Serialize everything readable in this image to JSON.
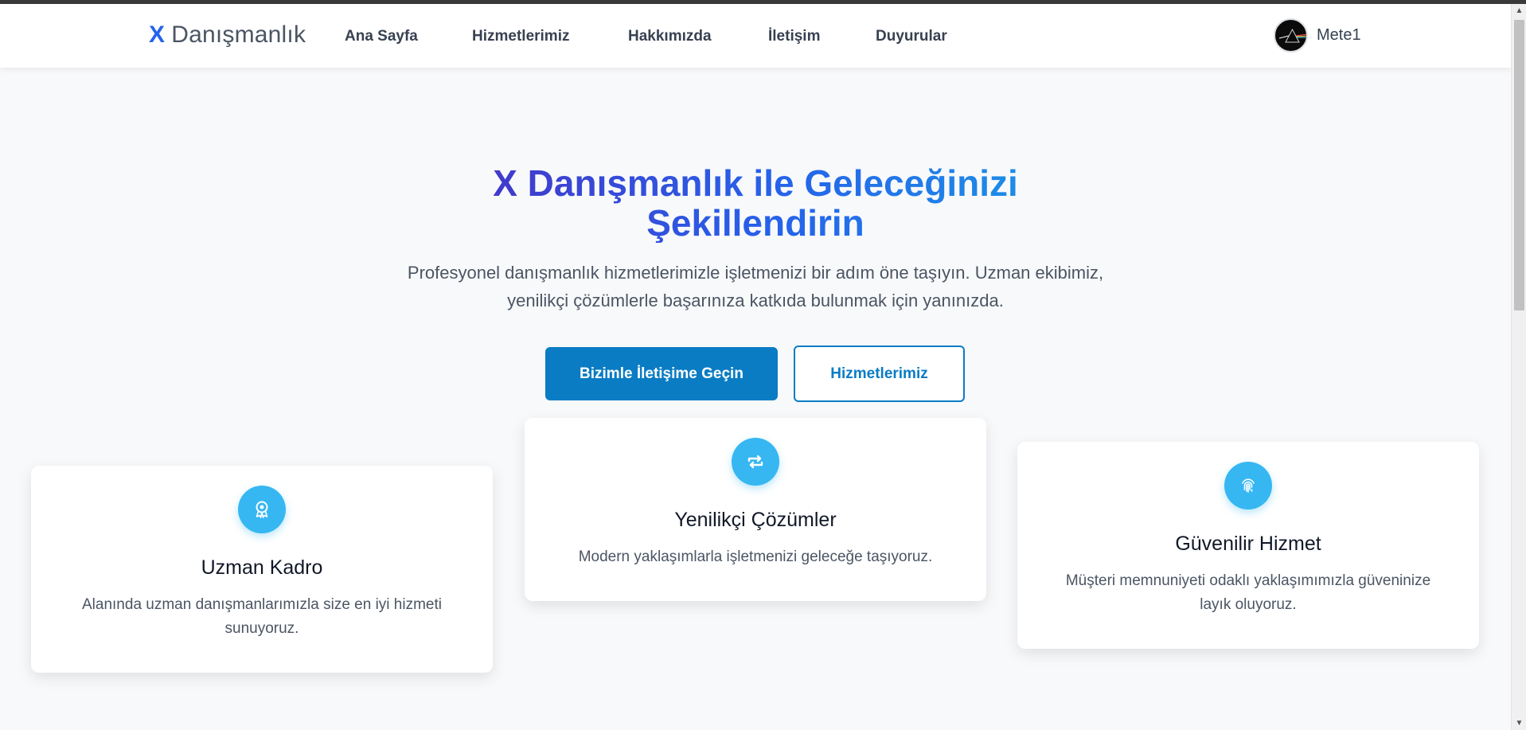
{
  "brand": {
    "mark": "X",
    "name": "Danışmanlık"
  },
  "nav": {
    "home": "Ana Sayfa",
    "services": "Hizmetlerimiz",
    "about": "Hakkımızda",
    "contact": "İletişim",
    "announcements": "Duyurular"
  },
  "user": {
    "name": "Mete1"
  },
  "hero": {
    "title": "X Danışmanlık ile Geleceğinizi Şekillendirin",
    "subtitle": "Profesyonel danışmanlık hizmetlerimizle işletmenizi bir adım öne taşıyın. Uzman ekibimiz, yenilikçi çözümlerle başarınıza katkıda bulunmak için yanınızda.",
    "primary_button": "Bizimle İletişime Geçin",
    "secondary_button": "Hizmetlerimiz"
  },
  "features": [
    {
      "icon": "award-icon",
      "title": "Uzman Kadro",
      "text": "Alanında uzman danışmanlarımızla size en iyi hizmeti sunuyoruz."
    },
    {
      "icon": "repeat-icon",
      "title": "Yenilikçi Çözümler",
      "text": "Modern yaklaşımlarla işletmenizi geleceğe taşıyoruz."
    },
    {
      "icon": "fingerprint-icon",
      "title": "Güvenilir Hizmet",
      "text": "Müşteri memnuniyeti odaklı yaklaşımımızla güveninize layık oluyoruz."
    }
  ],
  "colors": {
    "accent": "#0a7cc4",
    "icon_bg": "#36b7f2",
    "title_gradient_start": "#4338ca",
    "title_gradient_end": "#1d8fe6",
    "page_bg": "#f8f9fb"
  }
}
